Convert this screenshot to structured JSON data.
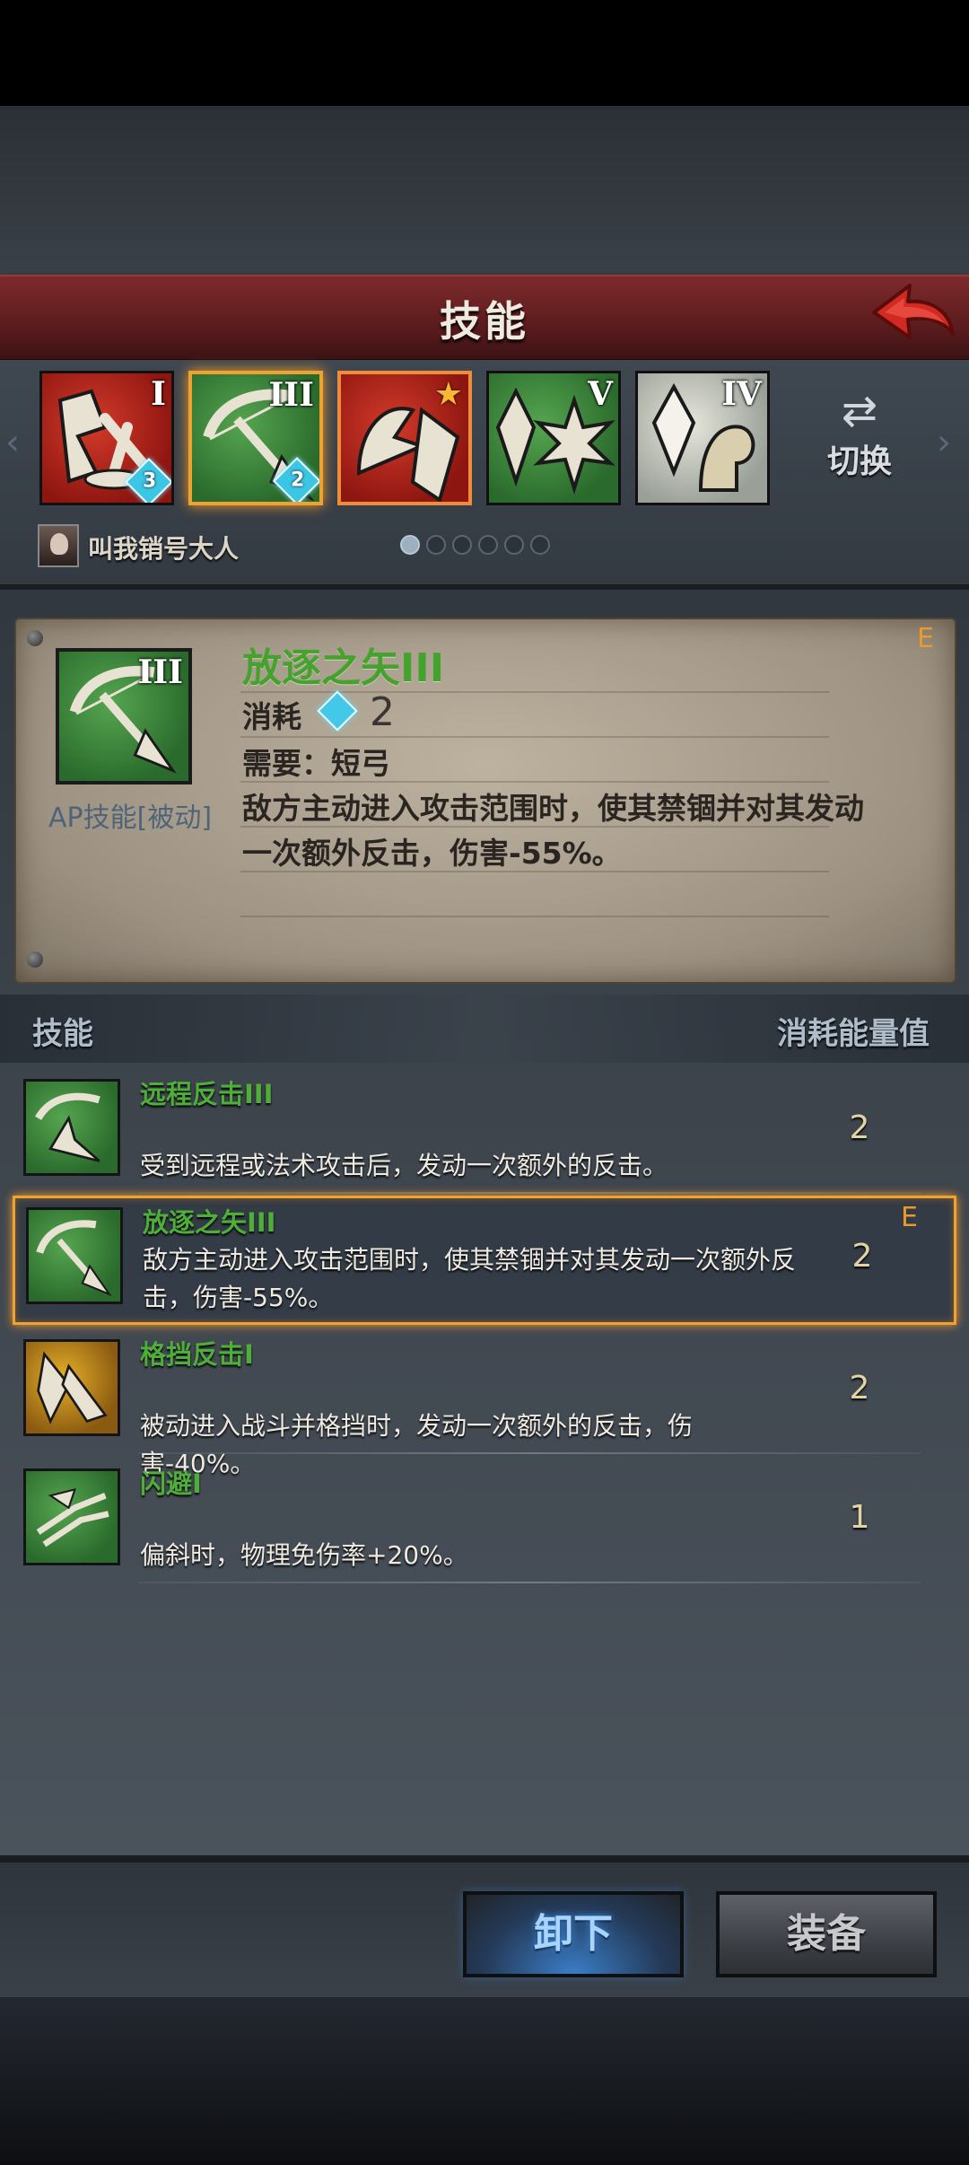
{
  "header": {
    "title": "技能"
  },
  "skill_slots": [
    {
      "roman": "I",
      "color": "red",
      "gem": "3"
    },
    {
      "roman": "III",
      "color": "green",
      "gem": "2",
      "selected": true
    },
    {
      "roman": "",
      "color": "red",
      "star": true
    },
    {
      "roman": "V",
      "color": "green"
    },
    {
      "roman": "IV",
      "color": "white"
    }
  ],
  "switch": {
    "label": "切换"
  },
  "player": {
    "name": "叫我销号大人"
  },
  "pager": {
    "count": 6,
    "active": 0
  },
  "detail": {
    "title": "放逐之矢III",
    "roman": "III",
    "type": "AP技能[被动]",
    "cost_label": "消耗",
    "cost_value": "2",
    "requirement": "需要：短弓",
    "description": "敌方主动进入攻击范围时，使其禁锢并对其发动一次额外反击，伤害-55%。",
    "corner": "E"
  },
  "list_header": {
    "left": "技能",
    "right": "消耗能量值"
  },
  "skills": [
    {
      "name": "远程反击III",
      "desc": "受到远程或法术攻击后，发动一次额外的反击。",
      "cost": "2"
    },
    {
      "name": "放逐之矢III",
      "desc": "敌方主动进入攻击范围时，使其禁锢并对其发动一次额外反击，伤害-55%。",
      "cost": "2",
      "corner": "E"
    },
    {
      "name": "格挡反击I",
      "desc": "被动进入战斗并格挡时，发动一次额外的反击，伤害-40%。",
      "cost": "2"
    },
    {
      "name": "闪避I",
      "desc": "偏斜时，物理免伤率+20%。",
      "cost": "1"
    }
  ],
  "buttons": {
    "unload": "卸下",
    "equip": "装备"
  },
  "colors": {
    "accent_orange": "#f0a130",
    "skill_green": "#4fae3a",
    "banner_red": "#7e2a2c",
    "gem_cyan": "#43c8e8"
  }
}
